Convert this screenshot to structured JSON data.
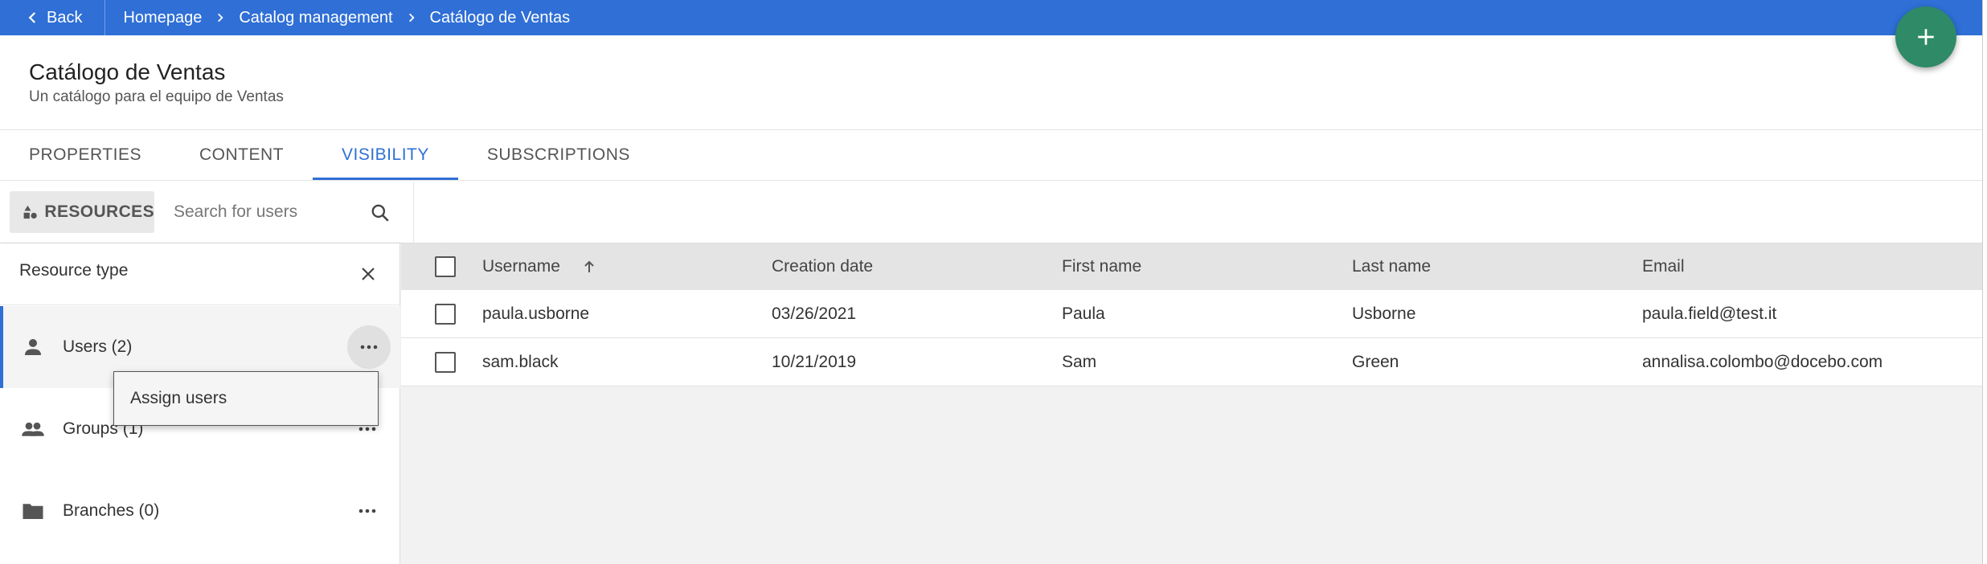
{
  "topbar": {
    "back_label": "Back",
    "breadcrumbs": [
      "Homepage",
      "Catalog management",
      "Catálogo de Ventas"
    ],
    "color": "#2f6fd6"
  },
  "fab": {
    "icon": "plus-icon",
    "color": "#2f8a67"
  },
  "header": {
    "title": "Catálogo de Ventas",
    "subtitle": "Un catálogo para el equipo de Ventas"
  },
  "tabs": [
    {
      "label": "PROPERTIES",
      "active": false
    },
    {
      "label": "CONTENT",
      "active": false
    },
    {
      "label": "VISIBILITY",
      "active": true
    },
    {
      "label": "SUBSCRIPTIONS",
      "active": false
    }
  ],
  "toolbar": {
    "resources_label": "RESOURCES",
    "resources_icon": "shapes-icon",
    "search_placeholder": "Search for users",
    "search_value": ""
  },
  "panel": {
    "title": "Resource type",
    "items": [
      {
        "label": "Users (2)",
        "icon": "person-icon",
        "active": true
      },
      {
        "label": "Groups (1)",
        "icon": "group-icon",
        "active": false
      },
      {
        "label": "Branches (0)",
        "icon": "folder-icon",
        "active": false
      }
    ],
    "menu": {
      "item": "Assign users"
    }
  },
  "grid": {
    "columns": [
      "Username",
      "Creation date",
      "First name",
      "Last name",
      "Email"
    ],
    "sorted_column": "Username",
    "sort_direction": "ascending",
    "rows": [
      {
        "username": "paula.usborne",
        "creation_date": "03/26/2021",
        "first_name": "Paula",
        "last_name": "Usborne",
        "email": "paula.field@test.it"
      },
      {
        "username": "sam.black",
        "creation_date": "10/21/2019",
        "first_name": "Sam",
        "last_name": "Green",
        "email": "annalisa.colombo@docebo.com"
      }
    ]
  }
}
